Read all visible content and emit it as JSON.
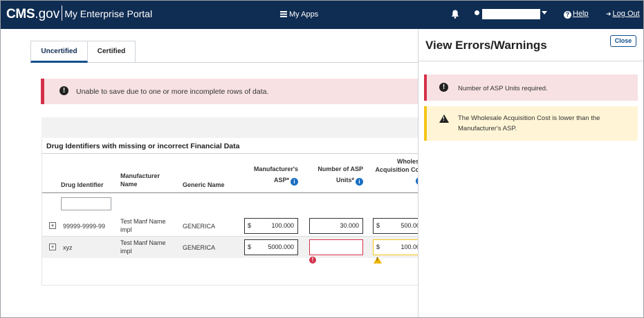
{
  "header": {
    "brand_cms": "CMS",
    "brand_gov": ".gov",
    "portal_name": "My Enterprise Portal",
    "apps_label": "My Apps",
    "help_label": "Help",
    "logout_label": "Log Out",
    "colors": {
      "navy": "#0f2c52",
      "white": "#ffffff"
    },
    "icons": [
      "apps-icon",
      "bell-icon",
      "user-icon",
      "chevron-down-icon",
      "help-icon",
      "logout-icon"
    ]
  },
  "tabs": [
    {
      "label": "Uncertified",
      "active": true
    },
    {
      "label": "Certified",
      "active": false
    }
  ],
  "main_alert": {
    "text": "Unable to save due to one or more incomplete rows of data.",
    "color": "#d5304b"
  },
  "section": {
    "title": "Drug Identifiers with missing or incorrect Financial Data",
    "columns": {
      "drug_identifier": "Drug Identifier",
      "manufacturer_name_1": "Manufacturer",
      "manufacturer_name_2": "Name",
      "generic_name": "Generic Name",
      "asp_1": "Manufacturer's",
      "asp_2": "ASP*",
      "units_1": "Number of ASP",
      "units_2": "Units*",
      "wac_1": "Wholes",
      "wac_2": "Acquisition Co"
    },
    "info_icon_glyph": "i",
    "rows": [
      {
        "expand": "+",
        "drug_identifier": "99999-9999-99",
        "manufacturer_1": "Test Manf Name",
        "manufacturer_2": "impl",
        "generic": "GENERICA",
        "asp_currency": "$",
        "asp_value": "100.000",
        "units_value": "30.000",
        "wac_currency": "$",
        "wac_value": "500.00"
      },
      {
        "expand": "+",
        "drug_identifier": "xyz",
        "manufacturer_1": "Test Manf Name",
        "manufacturer_2": "impl",
        "generic": "GENERICA",
        "asp_currency": "$",
        "asp_value": "5000.000",
        "units_value": "",
        "units_status": "error",
        "wac_currency": "$",
        "wac_value": "100.00",
        "wac_status": "warning"
      }
    ]
  },
  "panel": {
    "title": "View Errors/Warnings",
    "close_label": "Close",
    "error_text": "Number of ASP Units required.",
    "warning_text": "The Wholesale Acquisition Cost is lower than the Manufacturer's ASP.",
    "colors": {
      "error": "#d5304b",
      "warning": "#f5c518"
    }
  }
}
